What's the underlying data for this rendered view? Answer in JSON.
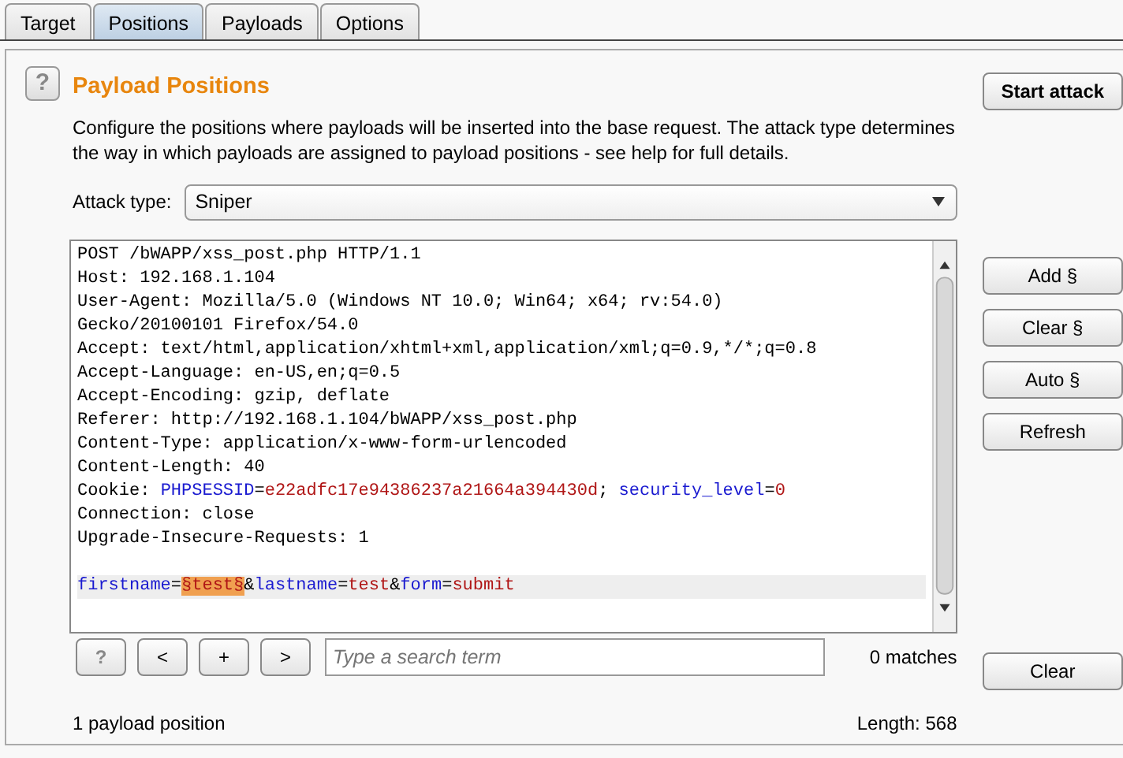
{
  "tabs": [
    {
      "label": "Target",
      "selected": false
    },
    {
      "label": "Positions",
      "selected": true
    },
    {
      "label": "Payloads",
      "selected": false
    },
    {
      "label": "Options",
      "selected": false
    }
  ],
  "section": {
    "title": "Payload Positions",
    "description": "Configure the positions where payloads will be inserted into the base request. The attack type determines the way in which payloads are assigned to payload positions - see help for full details.",
    "start_button": "Start attack"
  },
  "attack_type": {
    "label": "Attack type:",
    "value": "Sniper"
  },
  "request_lines": [
    {
      "highlighted": false,
      "segments": [
        {
          "kind": "plain",
          "text": "POST /bWAPP/xss_post.php HTTP/1.1"
        }
      ]
    },
    {
      "highlighted": false,
      "segments": [
        {
          "kind": "plain",
          "text": "Host: 192.168.1.104"
        }
      ]
    },
    {
      "highlighted": false,
      "segments": [
        {
          "kind": "plain",
          "text": "User-Agent: Mozilla/5.0 (Windows NT 10.0; Win64; x64; rv:54.0)"
        }
      ]
    },
    {
      "highlighted": false,
      "segments": [
        {
          "kind": "plain",
          "text": "Gecko/20100101 Firefox/54.0"
        }
      ]
    },
    {
      "highlighted": false,
      "segments": [
        {
          "kind": "plain",
          "text": "Accept: text/html,application/xhtml+xml,application/xml;q=0.9,*/*;q=0.8"
        }
      ]
    },
    {
      "highlighted": false,
      "segments": [
        {
          "kind": "plain",
          "text": "Accept-Language: en-US,en;q=0.5"
        }
      ]
    },
    {
      "highlighted": false,
      "segments": [
        {
          "kind": "plain",
          "text": "Accept-Encoding: gzip, deflate"
        }
      ]
    },
    {
      "highlighted": false,
      "segments": [
        {
          "kind": "plain",
          "text": "Referer: http://192.168.1.104/bWAPP/xss_post.php"
        }
      ]
    },
    {
      "highlighted": false,
      "segments": [
        {
          "kind": "plain",
          "text": "Content-Type: application/x-www-form-urlencoded"
        }
      ]
    },
    {
      "highlighted": false,
      "segments": [
        {
          "kind": "plain",
          "text": "Content-Length: 40"
        }
      ]
    },
    {
      "highlighted": false,
      "segments": [
        {
          "kind": "plain",
          "text": "Cookie: "
        },
        {
          "kind": "name",
          "text": "PHPSESSID"
        },
        {
          "kind": "plain",
          "text": "="
        },
        {
          "kind": "value",
          "text": "e22adfc17e94386237a21664a394430d"
        },
        {
          "kind": "plain",
          "text": "; "
        },
        {
          "kind": "name",
          "text": "security_level"
        },
        {
          "kind": "plain",
          "text": "="
        },
        {
          "kind": "value",
          "text": "0"
        }
      ]
    },
    {
      "highlighted": false,
      "segments": [
        {
          "kind": "plain",
          "text": "Connection: close"
        }
      ]
    },
    {
      "highlighted": false,
      "segments": [
        {
          "kind": "plain",
          "text": "Upgrade-Insecure-Requests: 1"
        }
      ]
    },
    {
      "highlighted": false
    },
    {
      "highlighted": true,
      "segments": [
        {
          "kind": "name",
          "text": "firstname"
        },
        {
          "kind": "plain",
          "text": "="
        },
        {
          "kind": "marker",
          "text": "§test§"
        },
        {
          "kind": "plain",
          "text": "&"
        },
        {
          "kind": "name",
          "text": "lastname"
        },
        {
          "kind": "plain",
          "text": "="
        },
        {
          "kind": "value",
          "text": "test"
        },
        {
          "kind": "plain",
          "text": "&"
        },
        {
          "kind": "name",
          "text": "form"
        },
        {
          "kind": "plain",
          "text": "="
        },
        {
          "kind": "value",
          "text": "submit"
        }
      ]
    }
  ],
  "side_buttons": [
    "Add §",
    "Clear §",
    "Auto §",
    "Refresh"
  ],
  "search": {
    "help": "?",
    "prev": "<",
    "add": "+",
    "next": ">",
    "placeholder": "Type a search term",
    "matches": "0 matches",
    "clear_button": "Clear"
  },
  "status": {
    "positions": "1 payload position",
    "length": "Length: 568"
  }
}
